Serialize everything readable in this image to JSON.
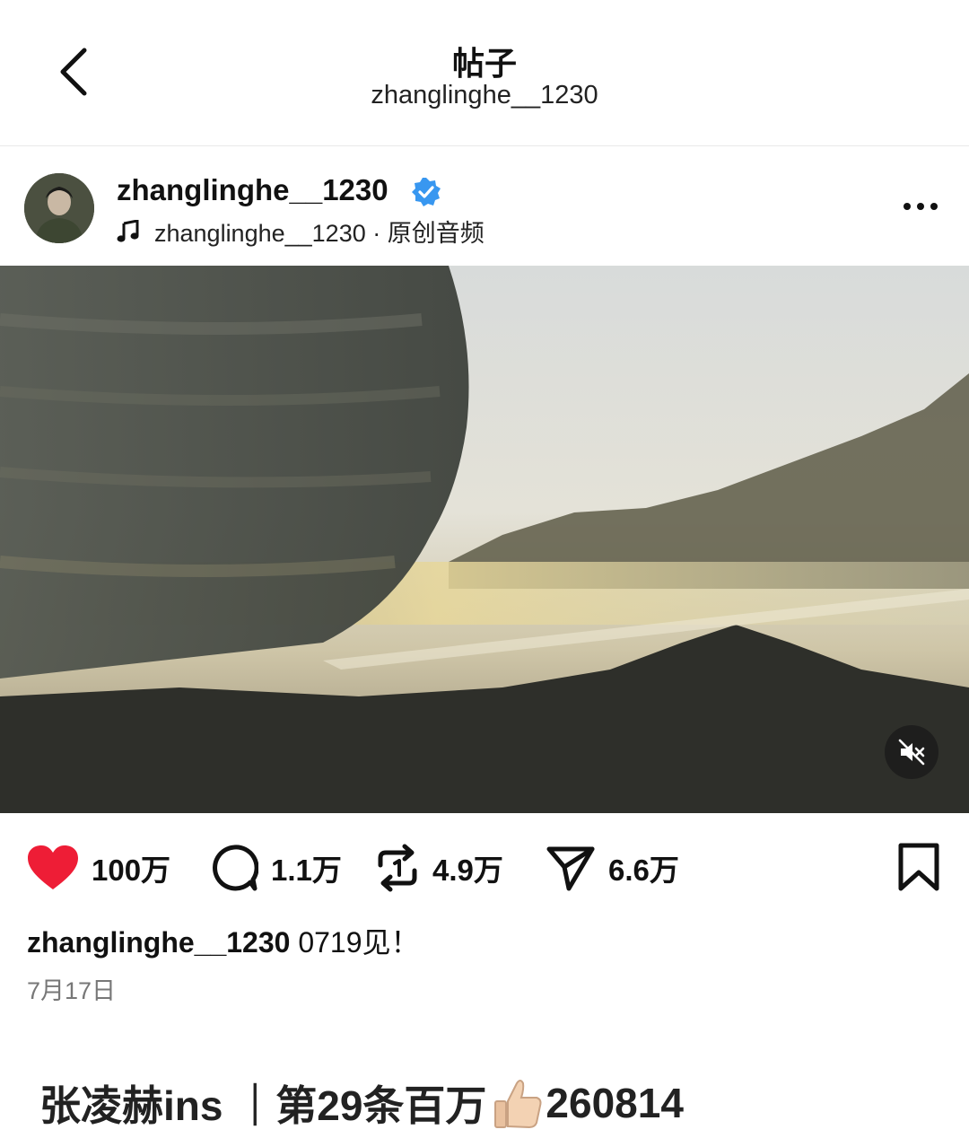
{
  "header": {
    "title": "帖子",
    "subtitle": "zhanglinghe__1230"
  },
  "post": {
    "username": "zhanglinghe__1230",
    "audio_label": "zhanglinghe__1230 · 原创音频",
    "media_state": "muted",
    "likes": "100万",
    "comments": "1.1万",
    "reposts": "4.9万",
    "shares": "6.6万",
    "caption_user": "zhanglinghe__1230",
    "caption_text": "0719见！",
    "date": "7月17日"
  },
  "footer": {
    "text_before": "张凌赫ins ｜第29条百万",
    "emoji": "thumbs-up",
    "text_after": "260814"
  },
  "colors": {
    "like": "#ee1d36",
    "verified": "#3897f0"
  }
}
